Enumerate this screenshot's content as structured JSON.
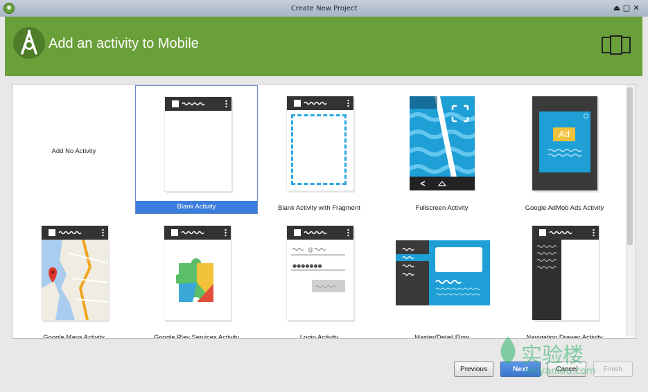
{
  "window": {
    "title": "Create New Project"
  },
  "header": {
    "title": "Add an activity to Mobile"
  },
  "activities": [
    {
      "label": "Add No Activity"
    },
    {
      "label": "Blank Activity",
      "selected": true
    },
    {
      "label": "Blank Activity with Fragment"
    },
    {
      "label": "Fullscreen Activity"
    },
    {
      "label": "Google AdMob Ads Activity",
      "ad_badge": "Ad"
    },
    {
      "label": "Google Maps Activity"
    },
    {
      "label": "Google Play Services Activity"
    },
    {
      "label": "Login Activity"
    },
    {
      "label": "Master/Detail Flow"
    },
    {
      "label": "Navigation Drawer Activity"
    }
  ],
  "footer": {
    "previous": "Previous",
    "next": "Next",
    "cancel": "Cancel",
    "finish": "Finish"
  },
  "watermark": {
    "text": "实验楼",
    "url": "shiyanlou.com"
  },
  "colors": {
    "header": "#6aa03a",
    "selection": "#3b7ddd",
    "accent": "#29a8e0"
  }
}
